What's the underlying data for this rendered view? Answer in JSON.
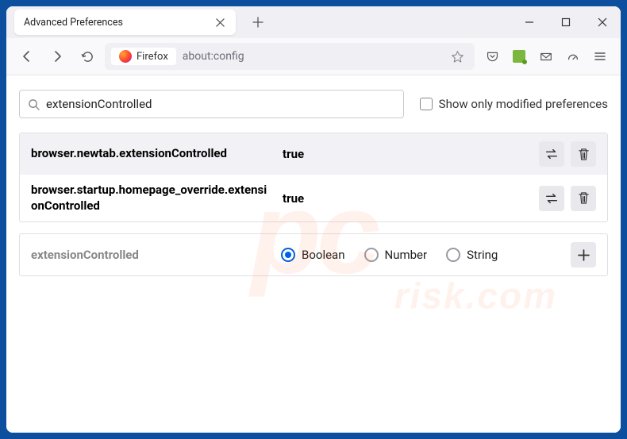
{
  "tab": {
    "title": "Advanced Preferences"
  },
  "url": {
    "identity": "Firefox",
    "path": "about:config"
  },
  "search": {
    "value": "extensionControlled",
    "modified_label": "Show only modified preferences"
  },
  "prefs": [
    {
      "name": "browser.newtab.extensionControlled",
      "value": "true"
    },
    {
      "name": "browser.startup.homepage_override.extensionControlled",
      "value": "true"
    }
  ],
  "newpref": {
    "name": "extensionControlled",
    "types": {
      "boolean": "Boolean",
      "number": "Number",
      "string": "String"
    }
  },
  "watermark": {
    "main": "pc",
    "sub": "risk.com"
  },
  "icons": {
    "close": "close-icon",
    "plus": "plus-icon",
    "min": "minimize-icon",
    "max": "maximize-icon",
    "back": "back-icon",
    "fwd": "forward-icon",
    "reload": "reload-icon",
    "star": "star-icon",
    "pocket": "pocket-icon",
    "ext": "extension-icon",
    "mail": "mail-icon",
    "dash": "dashboard-icon",
    "menu": "menu-icon",
    "search": "search-icon",
    "toggle": "toggle-icon",
    "trash": "trash-icon",
    "add": "add-icon"
  }
}
